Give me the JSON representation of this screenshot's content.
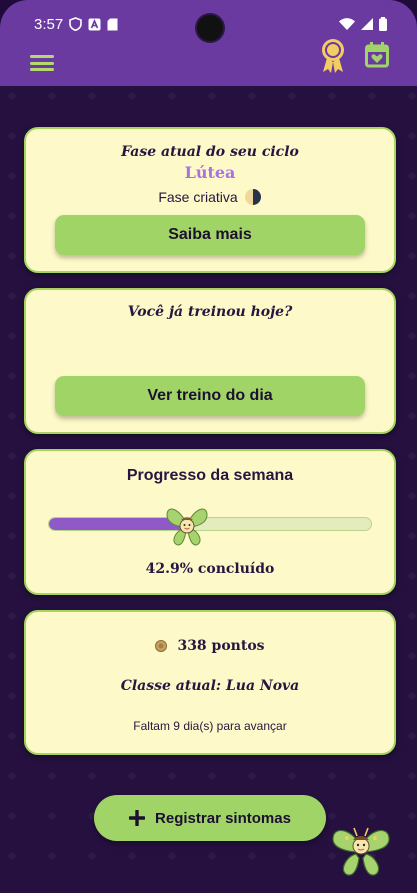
{
  "status_bar": {
    "time": "3:57"
  },
  "phase_card": {
    "heading": "Fase atual do seu ciclo",
    "phase_name": "Lútea",
    "phase_desc": "Fase criativa",
    "button_label": "Saiba mais"
  },
  "training_card": {
    "heading": "Você já treinou hoje?",
    "button_label": "Ver treino do dia"
  },
  "progress_card": {
    "heading": "Progresso da semana",
    "percent": 42.9,
    "caption": "42.9% concluído"
  },
  "points_card": {
    "points_text": "338 pontos",
    "class_text": "Classe atual: Lua Nova",
    "remaining_text": "Faltam 9 dia(s) para avançar"
  },
  "fab": {
    "label": "Registrar sintomas"
  },
  "colors": {
    "primary_purple": "#6b3aa0",
    "accent_green": "#a1d466",
    "card_bg": "#fdf9c8",
    "progress_purple": "#8f5ac8"
  }
}
